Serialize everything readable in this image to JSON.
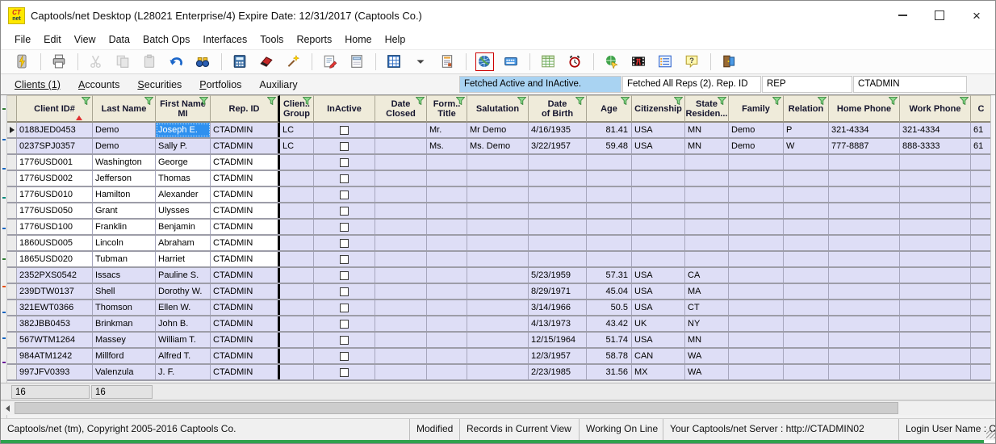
{
  "window": {
    "title": "Captools/net Desktop  (L28021 Enterprise/4) Expire Date: 12/31/2017 (Captools Co.)",
    "logo_top": "CT",
    "logo_bottom": "net"
  },
  "menu": {
    "items": [
      "File",
      "Edit",
      "View",
      "Data",
      "Batch Ops",
      "Interfaces",
      "Tools",
      "Reports",
      "Home",
      "Help"
    ]
  },
  "toolbar": {
    "groups": [
      [
        "fetch-power"
      ],
      [
        "print"
      ],
      [
        "cut",
        "copy",
        "paste",
        "undo",
        "find"
      ],
      [
        "calculator",
        "delete-eraser",
        "magic-wand"
      ],
      [
        "edit-record",
        "form-view"
      ],
      [
        "grid-view",
        "grid-view-dropdown",
        "report"
      ],
      [
        "internet-globe",
        "remote-keyboard"
      ],
      [
        "calc-sheet",
        "scheduler-clock"
      ],
      [
        "web-publish",
        "slideshow",
        "field-list",
        "help"
      ],
      [
        "exit-door"
      ]
    ],
    "disabled": [
      "cut",
      "copy",
      "paste"
    ],
    "highlighted": [
      "internet-globe"
    ]
  },
  "tabs": [
    {
      "label": "Clients (1)",
      "active": true,
      "accel": false
    },
    {
      "label": "Accounts",
      "active": false,
      "accel": true
    },
    {
      "label": "Securities",
      "active": false,
      "accel": true
    },
    {
      "label": "Portfolios",
      "active": false,
      "accel": true
    },
    {
      "label": "Auxiliary",
      "active": false,
      "accel": false
    }
  ],
  "fetch_panel": {
    "fetched_clients": "Fetched Active and InActive.",
    "fetched_reps": "Fetched All Reps (2). Rep. ID",
    "rep_field": "REP",
    "user_field": "CTADMIN",
    "highlight_color": "#A9D3F2"
  },
  "grid": {
    "selected": {
      "row": 0,
      "col": "first"
    },
    "columns": [
      {
        "key": "id",
        "label": "Client ID#",
        "width": 94,
        "sort": "asc"
      },
      {
        "key": "last",
        "label": "Last Name",
        "width": 78
      },
      {
        "key": "first",
        "label": "First Name",
        "label2": "MI",
        "width": 68
      },
      {
        "key": "rep",
        "label": "Rep. ID",
        "width": 86,
        "thick": true
      },
      {
        "key": "group",
        "label": "Clien..",
        "label2": "Group",
        "width": 42
      },
      {
        "key": "inactive",
        "label": "InActive",
        "width": 76,
        "type": "checkbox",
        "filter": false
      },
      {
        "key": "closed",
        "label": "Date",
        "label2": "Closed",
        "width": 64
      },
      {
        "key": "form",
        "label": "Form..",
        "label2": "Title",
        "width": 50
      },
      {
        "key": "salutation",
        "label": "Salutation",
        "width": 76
      },
      {
        "key": "dob",
        "label": "Date",
        "label2": "of Birth",
        "width": 72
      },
      {
        "key": "age",
        "label": "Age",
        "width": 56,
        "align": "right"
      },
      {
        "key": "citizenship",
        "label": "Citizenship",
        "width": 66
      },
      {
        "key": "state",
        "label": "State",
        "label2": "Residen...",
        "width": 54
      },
      {
        "key": "family",
        "label": "Family",
        "width": 68
      },
      {
        "key": "relation",
        "label": "Relation",
        "width": 56
      },
      {
        "key": "home",
        "label": "Home Phone",
        "width": 88
      },
      {
        "key": "work",
        "label": "Work Phone",
        "width": 88
      },
      {
        "key": "extra",
        "label": "C",
        "width": 26,
        "filter": false
      }
    ],
    "rows": [
      {
        "id": "0188JED0453",
        "last": "Demo",
        "first": "Joseph E.",
        "rep": "CTADMIN",
        "group": "LC",
        "form": "Mr.",
        "salutation": "Mr Demo",
        "dob": "4/16/1935",
        "age": "81.41",
        "citizenship": "USA",
        "state": "MN",
        "family": "Demo",
        "relation": "P",
        "home": "321-4334",
        "work": "321-4334",
        "extra": "61",
        "band": "lav"
      },
      {
        "id": "0237SPJ0357",
        "last": "Demo",
        "first": "Sally P.",
        "rep": "CTADMIN",
        "group": "LC",
        "form": "Ms.",
        "salutation": "Ms. Demo",
        "dob": "3/22/1957",
        "age": "59.48",
        "citizenship": "USA",
        "state": "MN",
        "family": "Demo",
        "relation": "W",
        "home": "777-8887",
        "work": "888-3333",
        "extra": "61",
        "band": "lav"
      },
      {
        "id": "1776USD001",
        "last": "Washington",
        "first": "George",
        "rep": "CTADMIN",
        "band": "white"
      },
      {
        "id": "1776USD002",
        "last": "Jefferson",
        "first": "Thomas",
        "rep": "CTADMIN",
        "band": "white"
      },
      {
        "id": "1776USD010",
        "last": "Hamilton",
        "first": "Alexander",
        "rep": "CTADMIN",
        "band": "white"
      },
      {
        "id": "1776USD050",
        "last": "Grant",
        "first": "Ulysses",
        "rep": "CTADMIN",
        "band": "white"
      },
      {
        "id": "1776USD100",
        "last": "Franklin",
        "first": "Benjamin",
        "rep": "CTADMIN",
        "band": "white"
      },
      {
        "id": "1860USD005",
        "last": "Lincoln",
        "first": "Abraham",
        "rep": "CTADMIN",
        "band": "white"
      },
      {
        "id": "1865USD020",
        "last": "Tubman",
        "first": "Harriet",
        "rep": "CTADMIN",
        "band": "white"
      },
      {
        "id": "2352PXS0542",
        "last": "Issacs",
        "first": "Pauline S.",
        "rep": "CTADMIN",
        "dob": "5/23/1959",
        "age": "57.31",
        "citizenship": "USA",
        "state": "CA",
        "band": "lav"
      },
      {
        "id": "239DTW0137",
        "last": "Shell",
        "first": "Dorothy W.",
        "rep": "CTADMIN",
        "dob": "8/29/1971",
        "age": "45.04",
        "citizenship": "USA",
        "state": "MA",
        "band": "lav"
      },
      {
        "id": "321EWT0366",
        "last": "Thomson",
        "first": "Ellen W.",
        "rep": "CTADMIN",
        "dob": "3/14/1966",
        "age": "50.5",
        "citizenship": "USA",
        "state": "CT",
        "band": "lav"
      },
      {
        "id": "382JBB0453",
        "last": "Brinkman",
        "first": "John B.",
        "rep": "CTADMIN",
        "dob": "4/13/1973",
        "age": "43.42",
        "citizenship": "UK",
        "state": "NY",
        "band": "lav"
      },
      {
        "id": "567WTM1264",
        "last": "Massey",
        "first": "William T.",
        "rep": "CTADMIN",
        "dob": "12/15/1964",
        "age": "51.74",
        "citizenship": "USA",
        "state": "MN",
        "band": "lav"
      },
      {
        "id": "984ATM1242",
        "last": "Millford",
        "first": "Alfred T.",
        "rep": "CTADMIN",
        "dob": "12/3/1957",
        "age": "58.78",
        "citizenship": "CAN",
        "state": "WA",
        "band": "lav"
      },
      {
        "id": "997JFV0393",
        "last": "Valenzula",
        "first": "J. F.",
        "rep": "CTADMIN",
        "dob": "2/23/1985",
        "age": "31.56",
        "citizenship": "MX",
        "state": "WA",
        "band": "lav"
      }
    ],
    "row_color": "#DEDEF6",
    "header_color": "#EFEBDA"
  },
  "footer": {
    "left": "16",
    "right": "16"
  },
  "statusbar": {
    "copyright": "Captools/net (tm), Copyright 2005-2016 Captools Co.",
    "modified": "Modified",
    "records": "Records in Current View",
    "online": "Working On Line",
    "server": "Your Captools/net Server : http://CTADMIN02",
    "login": "Login User Name : CTADMIN"
  }
}
